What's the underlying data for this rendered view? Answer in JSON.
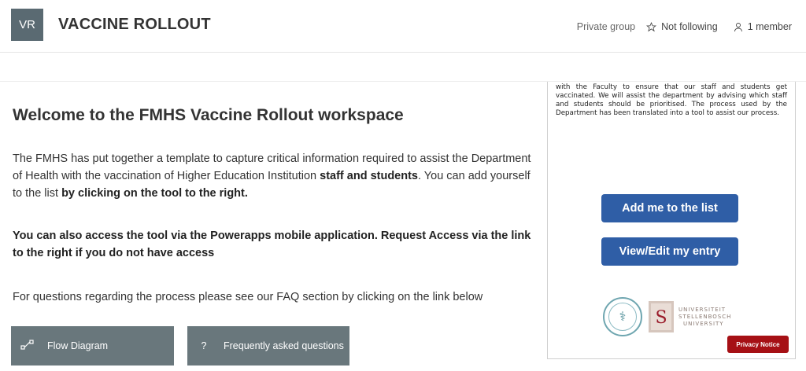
{
  "header": {
    "avatar_initials": "VR",
    "title": "VACCINE ROLLOUT",
    "privacy": "Private group",
    "follow_label": "Not following",
    "members_label": "1 member"
  },
  "main": {
    "heading": "Welcome to the FMHS Vaccine Rollout workspace",
    "p1_part1": "The FMHS has put together a template  to capture critical information required to assist the Department of Health with the vaccination of Higher Education Institution ",
    "p1_bold": "staff and students",
    "p1_part2": ". You can add yourself to the list ",
    "p1_bold2": "by clicking on the tool to the right.",
    "p2_bold": "You can also access the tool via the Powerapps mobile application. Request Access via the link to the right if you do not have access",
    "p3": "For questions regarding the process please see our FAQ section by clicking on the link below",
    "tiles": [
      {
        "label": "Flow Diagram",
        "icon": "flow-icon"
      },
      {
        "label": "Frequently asked questions",
        "icon": "question-icon"
      }
    ]
  },
  "panel": {
    "text": "Department of Health (WCG: Health) as our key partner is working with the Faculty to ensure that our staff and students get vaccinated. We will assist the department by advising which staff and students should be prioritised. The process used by the Department has been translated into a tool to assist our process.",
    "add_button": "Add me to the list",
    "edit_button": "View/Edit my entry",
    "uni_line1": "UNIVERSITEIT",
    "uni_line2": "STELLENBOSCH",
    "uni_line3": "UNIVERSITY",
    "privacy_button": "Privacy Notice"
  },
  "colors": {
    "avatar": "#5a6a72",
    "tile": "#69777c",
    "primary_button": "#2f5ea6",
    "privacy_button": "#a61015"
  }
}
